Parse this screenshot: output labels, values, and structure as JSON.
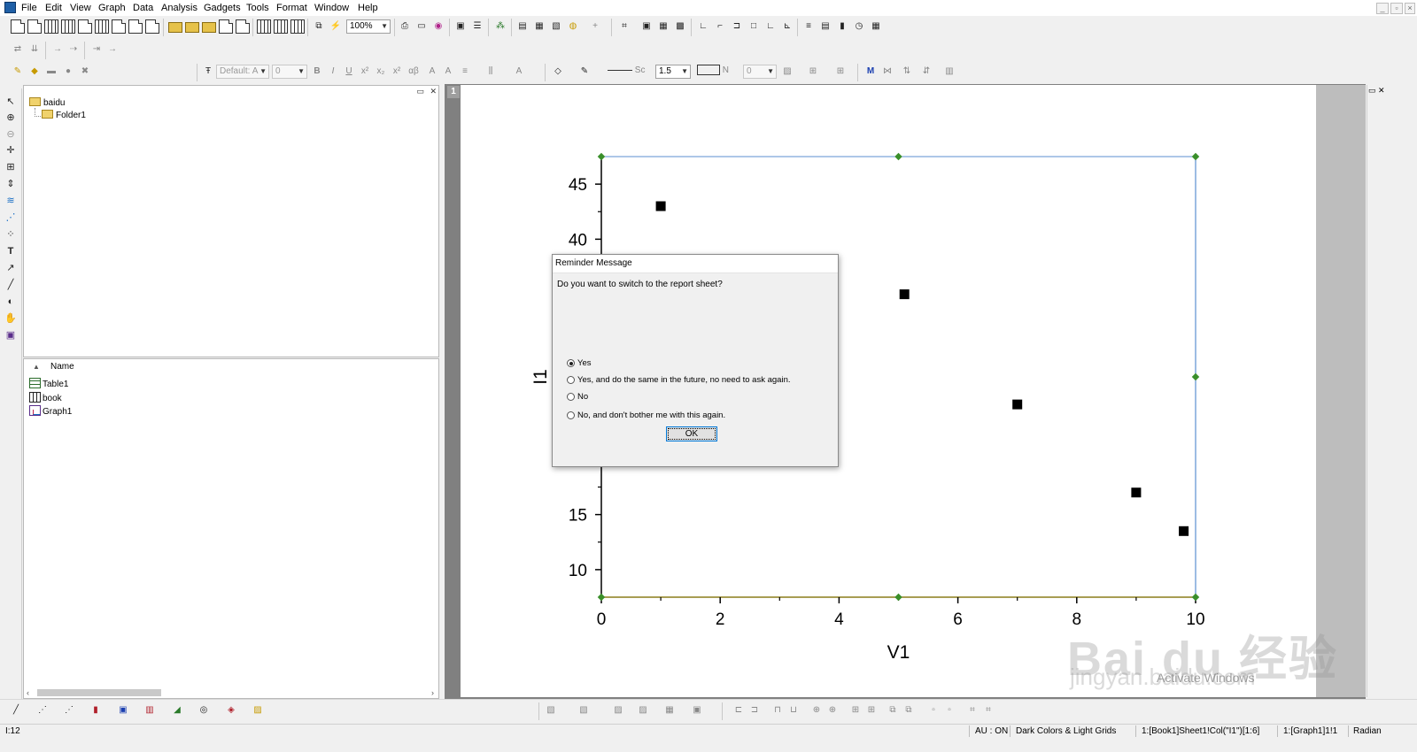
{
  "menubar": {
    "items": [
      "File",
      "Edit",
      "View",
      "Graph",
      "Data",
      "Analysis",
      "Gadgets",
      "Tools",
      "Format",
      "Window",
      "Help"
    ]
  },
  "toolbar": {
    "zoom_value": "100%",
    "font_name": "Default: A",
    "font_size": "0",
    "line_style": "Sc",
    "line_width": "1.5",
    "fill_value": "N",
    "pattern_size": "0"
  },
  "project_explorer": {
    "root": "baidu",
    "folder": "Folder1",
    "list_header": "Name",
    "items": [
      {
        "name": "Table1",
        "icon": "table-icon"
      },
      {
        "name": "book",
        "icon": "workbook-icon"
      },
      {
        "name": "Graph1",
        "icon": "graph-icon"
      }
    ]
  },
  "graph": {
    "layer_number": "1"
  },
  "chart_data": {
    "type": "scatter",
    "xlabel": "V1",
    "ylabel": "I1",
    "xlim": [
      0,
      10
    ],
    "ylim": [
      7.5,
      47.5
    ],
    "x_ticks": [
      "0",
      "2",
      "4",
      "6",
      "8",
      "10"
    ],
    "y_ticks": [
      "10",
      "15",
      "40",
      "45"
    ],
    "points": [
      {
        "x": 1.0,
        "y": 43
      },
      {
        "x": 5.1,
        "y": 35
      },
      {
        "x": 7.0,
        "y": 25
      },
      {
        "x": 9.0,
        "y": 17
      },
      {
        "x": 9.8,
        "y": 13.5
      }
    ]
  },
  "dialog": {
    "title": "Reminder Message",
    "question": "Do you want to switch to the report sheet?",
    "options": [
      "Yes",
      "Yes, and do the same in the future, no need to ask again.",
      "No",
      "No, and don't bother me with this again."
    ],
    "selected_index": 0,
    "ok_label": "OK"
  },
  "statusbar": {
    "left": "I:12",
    "au": "AU : ON",
    "theme": "Dark Colors & Light Grids",
    "cell_ref": "1:[Book1]Sheet1!Col(\"I1\")[1:6]",
    "graph_ref": "1:[Graph1]1!1",
    "angle": "Radian"
  },
  "watermark": {
    "brand": "Bai du 经验",
    "url": "jingyan.baidu.com",
    "activate": "Activate Windows"
  },
  "colors": {
    "axis": "#000000",
    "frame_right": "#5b8fd0",
    "frame_bottom": "#8b7d1a",
    "handle": "#3a8f2a",
    "dialog_ok_border": "#0078d7"
  }
}
